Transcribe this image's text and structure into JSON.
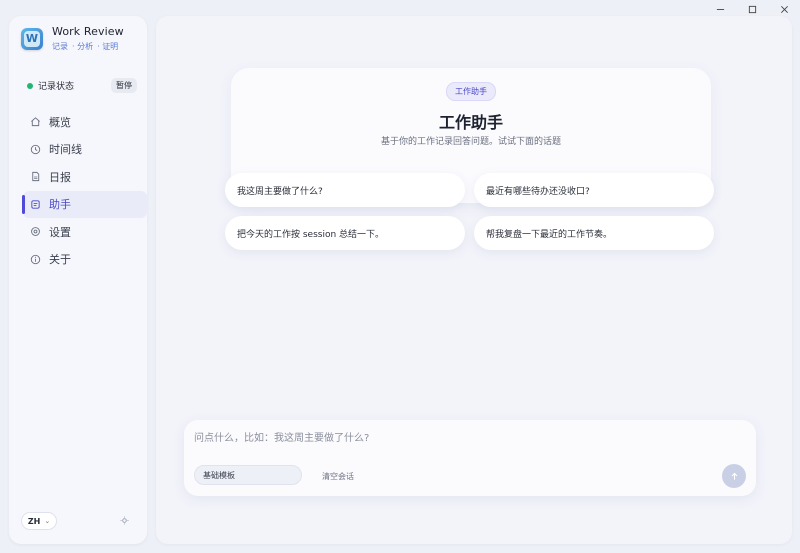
{
  "window": {
    "controls": [
      "minimize",
      "maximize",
      "close"
    ]
  },
  "sidebar": {
    "app_title": "Work Review",
    "app_subtitle": [
      "记录",
      "分析",
      "证明"
    ],
    "status": {
      "label": "记录状态",
      "action": "暂停",
      "color": "#22b573"
    },
    "items": [
      {
        "label": "概览",
        "icon": "home-icon"
      },
      {
        "label": "时间线",
        "icon": "clock-icon"
      },
      {
        "label": "日报",
        "icon": "document-icon"
      },
      {
        "label": "助手",
        "icon": "chat-icon",
        "active": true
      },
      {
        "label": "设置",
        "icon": "gear-icon"
      },
      {
        "label": "关于",
        "icon": "info-icon"
      }
    ],
    "language": "ZH"
  },
  "assistant": {
    "badge": "工作助手",
    "title": "工作助手",
    "subtitle": "基于你的工作记录回答问题。试试下面的话题",
    "suggestions": [
      "我这周主要做了什么?",
      "最近有哪些待办还没收口?",
      "把今天的工作按 session 总结一下。",
      "帮我复盘一下最近的工作节奏。"
    ]
  },
  "composer": {
    "placeholder": "问点什么，比如：我这周主要做了什么?",
    "template": "基础模板",
    "clear_label": "清空会话"
  },
  "colors": {
    "accent": "#4f4bd8",
    "background": "#eef0f7"
  }
}
